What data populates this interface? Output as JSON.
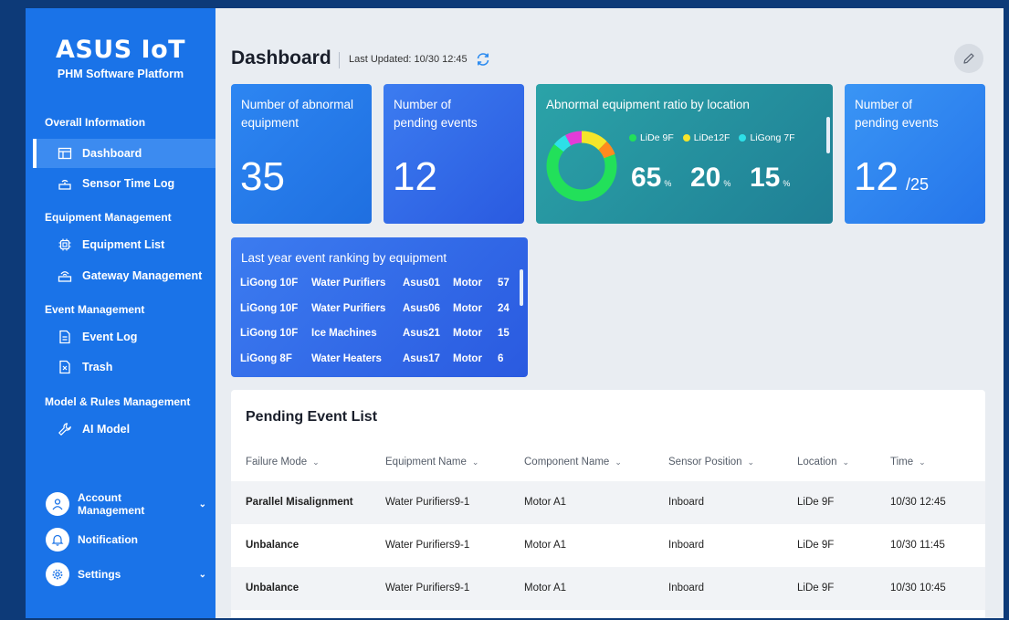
{
  "sidebar": {
    "brand": "ASUS IoT",
    "platform": "PHM Software Platform",
    "sections": {
      "overall": "Overall Information",
      "equipment": "Equipment Management",
      "event": "Event Management",
      "model": "Model & Rules Management"
    },
    "items": {
      "dashboard": "Dashboard",
      "sensor_time_log": "Sensor Time Log",
      "equipment_list": "Equipment List",
      "gateway_management": "Gateway Management",
      "event_log": "Event Log",
      "trash": "Trash",
      "ai_model": "AI Model"
    },
    "bottom": {
      "account": "Account Management",
      "notification": "Notification",
      "settings": "Settings"
    }
  },
  "header": {
    "title": "Dashboard",
    "last_updated": "Last Updated: 10/30 12:45"
  },
  "cards": {
    "abnormal": {
      "title_line1": "Number of abnormal",
      "title_line2": "equipment",
      "value": "35"
    },
    "pending": {
      "title_line1": "Number of",
      "title_line2": "pending events",
      "value": "12"
    },
    "ratio": {
      "title": "Abnormal equipment ratio by location",
      "legend": [
        {
          "label": "LiDe 9F",
          "color": "#22e05a"
        },
        {
          "label": "LiDe12F",
          "color": "#f5e52a"
        },
        {
          "label": "LiGong 7F",
          "color": "#2de0e8"
        }
      ],
      "values": [
        {
          "value": "65",
          "unit": "%"
        },
        {
          "value": "20",
          "unit": "%"
        },
        {
          "value": "15",
          "unit": "%"
        }
      ]
    },
    "pending_total": {
      "title_line1": "Number of",
      "title_line2": "pending events",
      "value": "12",
      "total": "/25"
    },
    "ranking": {
      "title": "Last year event ranking by equipment",
      "rows": [
        [
          "LiGong 10F",
          "Water Purifiers",
          "Asus01",
          "Motor",
          "57"
        ],
        [
          "LiGong 10F",
          "Water Purifiers",
          "Asus06",
          "Motor",
          "24"
        ],
        [
          "LiGong 10F",
          "Ice Machines",
          "Asus21",
          "Motor",
          "15"
        ],
        [
          "LiGong 8F",
          "Water Heaters",
          "Asus17",
          "Motor",
          "6"
        ]
      ]
    }
  },
  "table": {
    "title": "Pending Event List",
    "columns": [
      "Failure Mode",
      "Equipment Name",
      "Component Name",
      "Sensor Position",
      "Location",
      "Time"
    ],
    "rows": [
      [
        "Parallel Misalignment",
        "Water Purifiers9-1",
        "Motor A1",
        "Inboard",
        "LiDe 9F",
        "10/30 12:45"
      ],
      [
        "Unbalance",
        "Water Purifiers9-1",
        "Motor A1",
        "Inboard",
        "LiDe 9F",
        "10/30 11:45"
      ],
      [
        "Unbalance",
        "Water Purifiers9-1",
        "Motor A1",
        "Inboard",
        "LiDe 9F",
        "10/30 10:45"
      ]
    ]
  }
}
